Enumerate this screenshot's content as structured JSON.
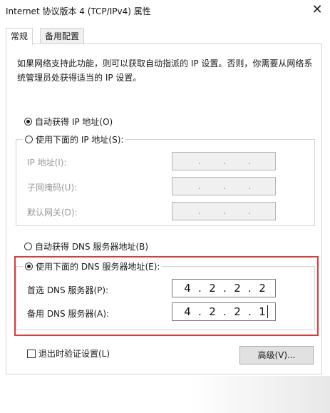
{
  "window": {
    "title": "Internet 协议版本 4 (TCP/IPv4) 属性"
  },
  "icons": {
    "close": "close-icon"
  },
  "tabs": [
    {
      "label": "常规"
    },
    {
      "label": "备用配置"
    }
  ],
  "description": "如果网络支持此功能，则可以获取自动指派的 IP 设置。否则，你需要从网络系统管理员处获得适当的 IP 设置。",
  "ip_mode": {
    "auto_label": "自动获得 IP 地址(O)",
    "manual_label": "使用下面的 IP 地址(S):",
    "selected": "auto"
  },
  "ip_fields": {
    "ip_label": "IP 地址(I):",
    "mask_label": "子网掩码(U):",
    "gateway_label": "默认网关(D):",
    "dot": "."
  },
  "dns_mode": {
    "auto_label": "自动获得 DNS 服务器地址(B)",
    "manual_label": "使用下面的 DNS 服务器地址(E):",
    "selected": "manual"
  },
  "dns_fields": {
    "preferred_label": "首选 DNS 服务器(P):",
    "alternate_label": "备用 DNS 服务器(A):",
    "preferred": [
      "4",
      "2",
      "2",
      "2"
    ],
    "alternate": [
      "4",
      "2",
      "2",
      "1"
    ],
    "dot": "."
  },
  "validate_label": "退出时验证设置(L)",
  "advanced_button": "高级(V)...",
  "colors": {
    "highlight_border": "#e0383a"
  }
}
